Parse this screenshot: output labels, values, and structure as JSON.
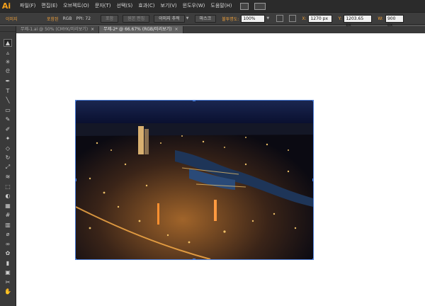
{
  "app": {
    "logo": "Ai"
  },
  "menu": [
    "파일(F)",
    "편집(E)",
    "오브젝트(O)",
    "문자(T)",
    "선택(S)",
    "효과(C)",
    "보기(V)",
    "윈도우(W)",
    "도움말(H)"
  ],
  "control": {
    "title": "이미지",
    "link_label": "포함된",
    "color_mode": "RGB",
    "ppi": "PPI: 72",
    "embed_btn": "포함",
    "edit_original_btn": "원본 편집",
    "image_trace_btn": "이미지 추적",
    "mask_btn": "마스크",
    "opacity_label": "불투명도:",
    "opacity_value": "100%",
    "x_label": "X:",
    "x_value": "1270 px",
    "y_label": "Y:",
    "y_value": "1203.65 px",
    "w_label": "W:",
    "w_value": "900 px"
  },
  "tabs": [
    {
      "label": "무제-1.ai @ 50% (CMYK/미리보기)",
      "close": "×"
    },
    {
      "label": "무제-2* @ 66.67% (RGB/미리보기)",
      "close": "×"
    }
  ],
  "tools": [
    "selection-tool-icon",
    "direct-selection-tool-icon",
    "magic-wand-tool-icon",
    "lasso-tool-icon",
    "pen-tool-icon",
    "type-tool-icon",
    "line-segment-tool-icon",
    "rectangle-tool-icon",
    "paintbrush-tool-icon",
    "pencil-tool-icon",
    "blob-brush-tool-icon",
    "eraser-tool-icon",
    "rotate-tool-icon",
    "scale-tool-icon",
    "width-tool-icon",
    "free-transform-tool-icon",
    "shape-builder-tool-icon",
    "perspective-grid-tool-icon",
    "mesh-tool-icon",
    "gradient-tool-icon",
    "eyedropper-tool-icon",
    "blend-tool-icon",
    "symbol-sprayer-tool-icon",
    "column-graph-tool-icon",
    "artboard-tool-icon",
    "slice-tool-icon",
    "hand-tool-icon"
  ],
  "colors": {
    "accent": "#f7a21b",
    "selection": "#4a7cd6"
  }
}
